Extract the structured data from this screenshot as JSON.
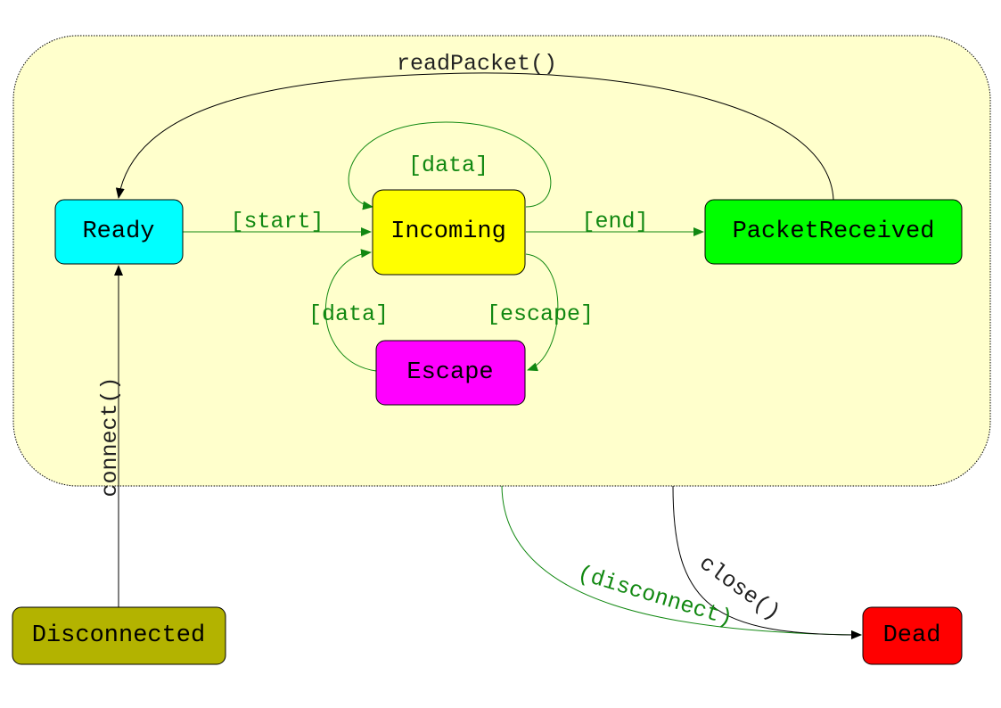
{
  "states": {
    "ready": {
      "label": "Ready",
      "color": "#00ffff"
    },
    "incoming": {
      "label": "Incoming",
      "color": "#ffff00"
    },
    "packet_received": {
      "label": "PacketReceived",
      "color": "#00ff00"
    },
    "escape": {
      "label": "Escape",
      "color": "#ff00ff"
    },
    "disconnected": {
      "label": "Disconnected",
      "color": "#b3b300"
    },
    "dead": {
      "label": "Dead",
      "color": "#ff0000"
    }
  },
  "composite_state": {
    "color": "#ffffcc"
  },
  "transitions": {
    "start": "[start]",
    "data_self": "[data]",
    "end": "[end]",
    "escape": "[escape]",
    "data_return": "[data]",
    "read_packet": "readPacket()",
    "connect": "connect()",
    "disconnect": "(disconnect)",
    "close": "close()"
  },
  "colors": {
    "guard_edge": "#118811",
    "call_edge": "#000000"
  }
}
